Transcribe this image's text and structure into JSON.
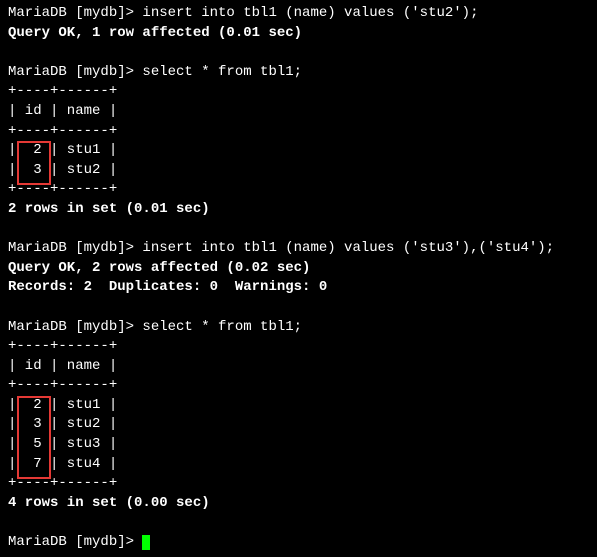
{
  "prompt": "MariaDB [mydb]> ",
  "cmds": {
    "insert1": "insert into tbl1 (name) values ('stu2');",
    "result1": "Query OK, 1 row affected (0.01 sec)",
    "select1": "select * from tbl1;",
    "insert2": "insert into tbl1 (name) values ('stu3'),('stu4');",
    "result2a": "Query OK, 2 rows affected (0.02 sec)",
    "result2b": "Records: 2  Duplicates: 0  Warnings: 0",
    "select2": "select * from tbl1;"
  },
  "table_border": "+----+------+",
  "table_header": "| id | name |",
  "table1": {
    "rows": [
      "|  2 | stu1 |",
      "|  3 | stu2 |"
    ],
    "summary": "2 rows in set (0.01 sec)"
  },
  "table2": {
    "rows": [
      "|  2 | stu1 |",
      "|  3 | stu2 |",
      "|  5 | stu3 |",
      "|  7 | stu4 |"
    ],
    "summary": "4 rows in set (0.00 sec)"
  },
  "chart_data": {
    "type": "table",
    "tables": [
      {
        "columns": [
          "id",
          "name"
        ],
        "rows": [
          {
            "id": 2,
            "name": "stu1"
          },
          {
            "id": 3,
            "name": "stu2"
          }
        ]
      },
      {
        "columns": [
          "id",
          "name"
        ],
        "rows": [
          {
            "id": 2,
            "name": "stu1"
          },
          {
            "id": 3,
            "name": "stu2"
          },
          {
            "id": 5,
            "name": "stu3"
          },
          {
            "id": 7,
            "name": "stu4"
          }
        ]
      }
    ]
  }
}
